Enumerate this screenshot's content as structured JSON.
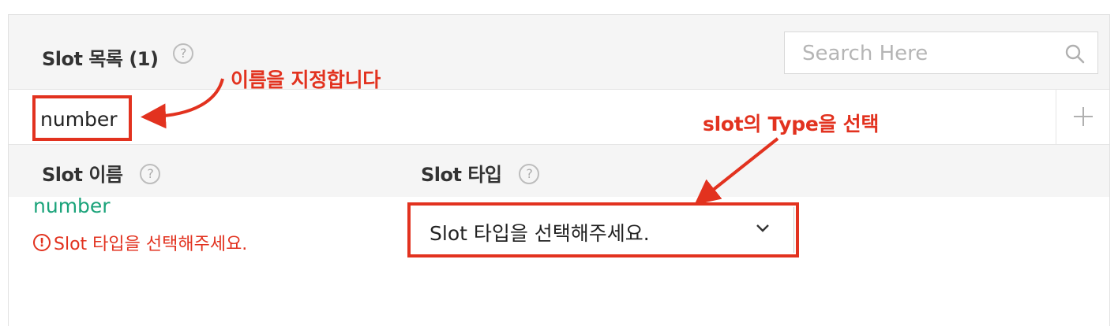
{
  "header": {
    "title": "Slot 목록 (1)",
    "help_glyph": "?",
    "search_placeholder": "Search Here"
  },
  "input_row": {
    "slot_name_value": "number",
    "add_glyph": "+"
  },
  "columns": {
    "name_label": "Slot 이름",
    "type_label": "Slot 타입",
    "help_glyph": "?"
  },
  "entry": {
    "name": "number",
    "error_glyph": "!",
    "error_text": "Slot 타입을 선택해주세요.",
    "type_select_value": "Slot 타입을 선택해주세요."
  },
  "annotations": {
    "name_hint": "이름을 지정합니다",
    "type_hint": "slot의 Type을 선택"
  },
  "colors": {
    "accent_red": "#e2321f",
    "name_green": "#1aa37a",
    "header_bg": "#f5f5f5"
  },
  "icons": [
    "help-icon",
    "search-icon",
    "plus-icon",
    "chevron-down-icon",
    "error-icon"
  ]
}
